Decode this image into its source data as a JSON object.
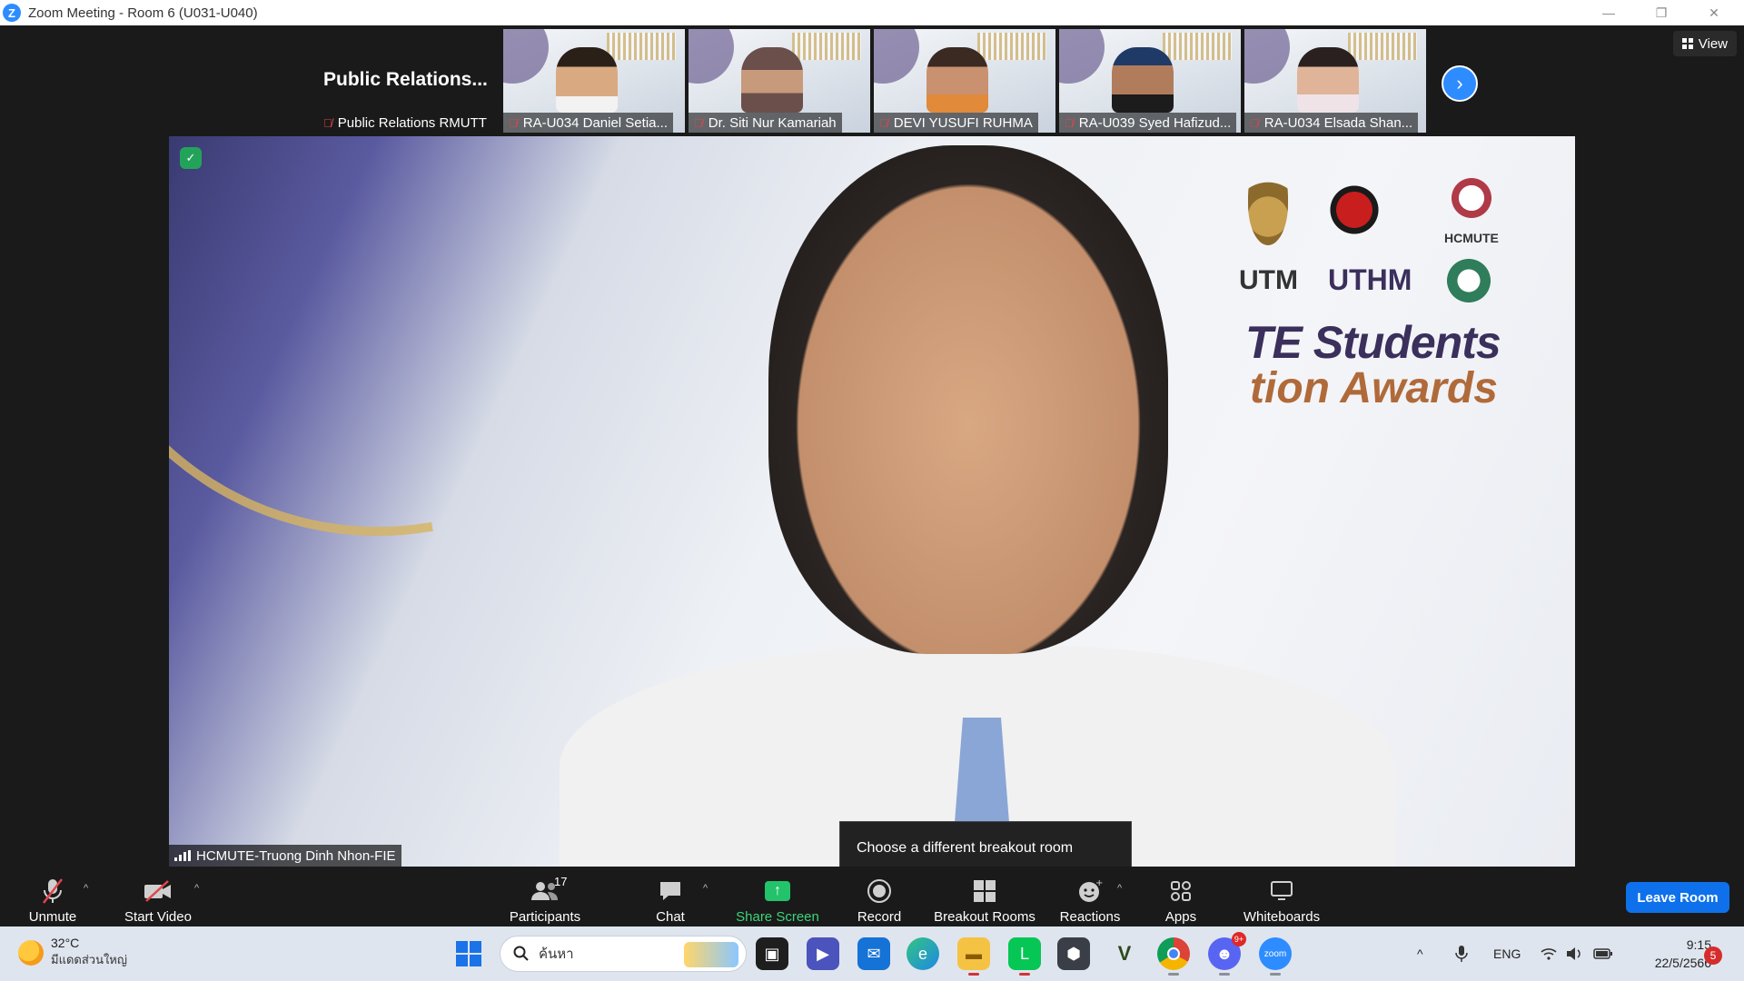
{
  "window": {
    "title": "Zoom Meeting - Room 6 (U031-U040)",
    "minimize_glyph": "—",
    "restore_glyph": "❐",
    "close_glyph": "✕"
  },
  "gallery": {
    "first_tile": {
      "big_name": "Public  Relations...",
      "label": "Public Relations RMUTT"
    },
    "tiles": [
      {
        "label": "RA-U034 Daniel Setia..."
      },
      {
        "label": "Dr. Siti Nur Kamariah"
      },
      {
        "label": "DEVI YUSUFI RUHMA"
      },
      {
        "label": "RA-U039 Syed Hafizud..."
      },
      {
        "label": "RA-U034 Elsada Shan..."
      }
    ],
    "next_icon": "›",
    "view_label": "View"
  },
  "main_video": {
    "speaker_name": "HCMUTE-Truong Dinh Nhon-FIE",
    "backdrop": {
      "logo_utm": "UTM",
      "logo_uthm": "UTHM",
      "logo_hcmute": "HCMUTE",
      "event_line1": "TE Students",
      "event_line2": "tion Awards"
    }
  },
  "tooltip": {
    "text": "Choose a different breakout room"
  },
  "toolbar": {
    "unmute": "Unmute",
    "start_video": "Start Video",
    "participants": "Participants",
    "participants_count": "17",
    "chat": "Chat",
    "share_screen": "Share Screen",
    "record": "Record",
    "breakout_rooms": "Breakout Rooms",
    "reactions": "Reactions",
    "apps": "Apps",
    "whiteboards": "Whiteboards",
    "leave_room": "Leave Room",
    "caret": "^"
  },
  "taskbar": {
    "weather_temp": "32°C",
    "weather_desc": "มีแดดส่วนใหญ่",
    "search_placeholder": "ค้นหา",
    "discord_badge": "9+",
    "language": "ENG",
    "time": "9:15",
    "date": "22/5/2566",
    "notifications": "5",
    "tray_up_glyph": "^"
  },
  "colors": {
    "accent": "#2d8cff",
    "share_green": "#23c36b",
    "leave_blue": "#0e71eb",
    "mic_red": "#e0454b"
  }
}
